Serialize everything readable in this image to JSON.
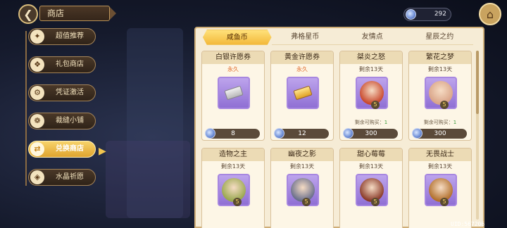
{
  "header": {
    "title": "商店"
  },
  "currency": {
    "amount": "292",
    "icon": "crystal-gem-icon"
  },
  "sidebar": {
    "items": [
      {
        "label": "超值推荐",
        "icon": "sparkle-icon",
        "glyph": "✦",
        "active": false
      },
      {
        "label": "礼包商店",
        "icon": "gift-icon",
        "glyph": "❖",
        "active": false
      },
      {
        "label": "凭证激活",
        "icon": "gear-icon",
        "glyph": "⚙",
        "active": false
      },
      {
        "label": "裁缝小铺",
        "icon": "button-icon",
        "glyph": "❁",
        "active": false
      },
      {
        "label": "兑换商店",
        "icon": "exchange-icon",
        "glyph": "⇄",
        "active": true
      },
      {
        "label": "水晶祈愿",
        "icon": "crystal-icon",
        "glyph": "◈",
        "active": false
      }
    ]
  },
  "tabs": [
    {
      "label": "咸鱼币",
      "active": true
    },
    {
      "label": "弗格星币",
      "active": false
    },
    {
      "label": "友情点",
      "active": false
    },
    {
      "label": "星辰之约",
      "active": false
    }
  ],
  "cards": [
    {
      "title": "白银许愿券",
      "sub": "永久",
      "subType": "perm",
      "art": "silver-ticket",
      "price": "8"
    },
    {
      "title": "黄金许愿券",
      "sub": "永久",
      "subType": "perm",
      "art": "gold-ticket",
      "price": "12"
    },
    {
      "title": "桀炎之怒",
      "sub": "剩余13天",
      "subType": "remain",
      "art": "portrait",
      "color": "#c9492d",
      "stars": "5",
      "limit_label": "剩余可购买：",
      "limit_value": "1",
      "price": "300"
    },
    {
      "title": "繁花之梦",
      "sub": "剩余13天",
      "subType": "remain",
      "art": "portrait",
      "color": "#d9a488",
      "stars": "5",
      "limit_label": "剩余可购买：",
      "limit_value": "1",
      "price": "300"
    },
    {
      "title": "造物之主",
      "sub": "剩余13天",
      "subType": "remain",
      "art": "portrait",
      "color": "#9aa850",
      "stars": "5"
    },
    {
      "title": "幽夜之影",
      "sub": "剩余13天",
      "subType": "remain",
      "art": "portrait",
      "color": "#6a6f8c",
      "stars": "5"
    },
    {
      "title": "甜心莓莓",
      "sub": "剩余13天",
      "subType": "remain",
      "art": "portrait",
      "color": "#8a3b2a",
      "stars": "5"
    },
    {
      "title": "无畏战士",
      "sub": "剩余13天",
      "subType": "remain",
      "art": "portrait",
      "color": "#b2702d",
      "stars": "5"
    }
  ],
  "footer": {
    "uid": "UID:567206"
  }
}
